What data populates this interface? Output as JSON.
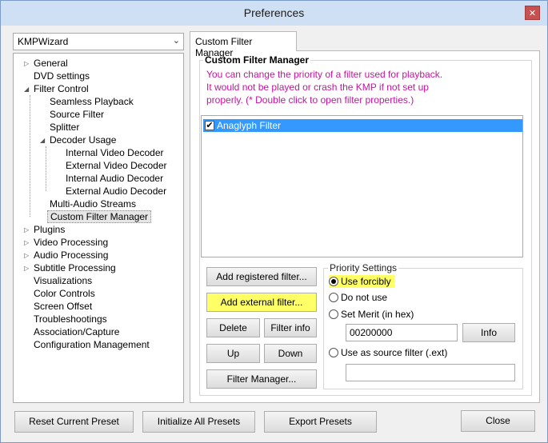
{
  "window": {
    "title": "Preferences",
    "close_glyph": "✕"
  },
  "preset": {
    "value": "KMPWizard"
  },
  "tree": {
    "items": [
      {
        "label": "General",
        "collapsed": true
      },
      {
        "label": "DVD settings"
      },
      {
        "label": "Filter Control",
        "expanded": true
      },
      {
        "label": "Seamless Playback"
      },
      {
        "label": "Source Filter"
      },
      {
        "label": "Splitter"
      },
      {
        "label": "Decoder Usage",
        "expanded": true
      },
      {
        "label": "Internal Video Decoder"
      },
      {
        "label": "External Video Decoder"
      },
      {
        "label": "Internal Audio Decoder"
      },
      {
        "label": "External Audio Decoder"
      },
      {
        "label": "Multi-Audio Streams"
      },
      {
        "label": "Custom Filter Manager",
        "selected": true
      },
      {
        "label": "Plugins",
        "collapsed": true
      },
      {
        "label": "Video Processing",
        "collapsed": true
      },
      {
        "label": "Audio Processing",
        "collapsed": true
      },
      {
        "label": "Subtitle Processing",
        "collapsed": true
      },
      {
        "label": "Visualizations"
      },
      {
        "label": "Color Controls"
      },
      {
        "label": "Screen Offset"
      },
      {
        "label": "Troubleshootings"
      },
      {
        "label": "Association/Capture"
      },
      {
        "label": "Configuration Management"
      }
    ]
  },
  "tab": {
    "label": "Custom Filter Manager"
  },
  "panel": {
    "group_title": "Custom Filter Manager",
    "description": [
      "You can change the priority of a filter used for playback.",
      "It would not be played or crash the KMP if not set up",
      "properly. (* Double click to open filter properties.)"
    ],
    "filters": [
      {
        "name": "Anaglyph Filter",
        "checked": true,
        "check_glyph": "✔"
      }
    ]
  },
  "buttons": {
    "add_registered": "Add registered filter...",
    "add_external": "Add external filter...",
    "delete": "Delete",
    "filter_info": "Filter info",
    "up": "Up",
    "down": "Down",
    "filter_manager": "Filter Manager...",
    "info": "Info",
    "reset_preset": "Reset Current Preset",
    "initialize_presets": "Initialize All Presets",
    "export_presets": "Export Presets",
    "close": "Close"
  },
  "priority": {
    "title": "Priority Settings",
    "use_forcibly": "Use forcibly",
    "do_not_use": "Do not use",
    "set_merit": "Set Merit (in hex)",
    "merit_value": "00200000",
    "use_as_source": "Use as source filter (.ext)",
    "source_ext_value": "",
    "selected": "use_forcibly"
  },
  "colors": {
    "highlight": "#ffff66",
    "description_text": "#c5139f",
    "selection": "#3399ff"
  }
}
